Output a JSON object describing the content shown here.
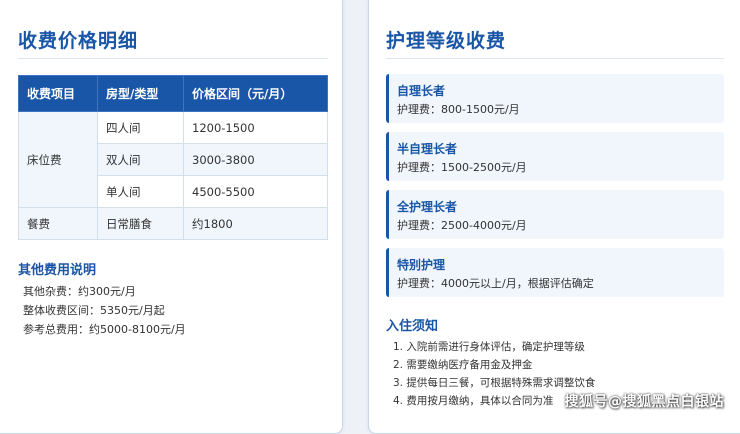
{
  "left": {
    "title": "收费价格明细",
    "table": {
      "headers": [
        "收费项目",
        "房型/类型",
        "价格区间（元/月）"
      ],
      "bed_label": "床位费",
      "bed_rows": [
        {
          "type": "四人间",
          "price": "1200-1500"
        },
        {
          "type": "双人间",
          "price": "3000-3800"
        },
        {
          "type": "单人间",
          "price": "4500-5500"
        }
      ],
      "meal": {
        "item": "餐费",
        "type": "日常膳食",
        "price": "约1800"
      }
    },
    "other_title": "其他费用说明",
    "other_lines": [
      "其他杂费：约300元/月",
      "整体收费区间：5350元/月起",
      "参考总费用：约5000-8100元/月"
    ]
  },
  "right": {
    "title": "护理等级收费",
    "levels": [
      {
        "name": "自理长者",
        "fee": "护理费：800-1500元/月"
      },
      {
        "name": "半自理长者",
        "fee": "护理费：1500-2500元/月"
      },
      {
        "name": "全护理长者",
        "fee": "护理费：2500-4000元/月"
      },
      {
        "name": "特别护理",
        "fee": "护理费：4000元以上/月，根据评估确定"
      }
    ],
    "notice_title": "入住须知",
    "notices": [
      "1. 入院前需进行身体评估，确定护理等级",
      "2. 需要缴纳医疗备用金及押金",
      "3. 提供每日三餐，可根据特殊需求调整饮食",
      "4. 费用按月缴纳，具体以合同为准"
    ]
  },
  "watermark": "搜狐号@搜狐黑点白银站",
  "colors": {
    "accent": "#1a56a8",
    "row_alt": "#f1f6fc",
    "page_bg": "#eef2f7"
  }
}
